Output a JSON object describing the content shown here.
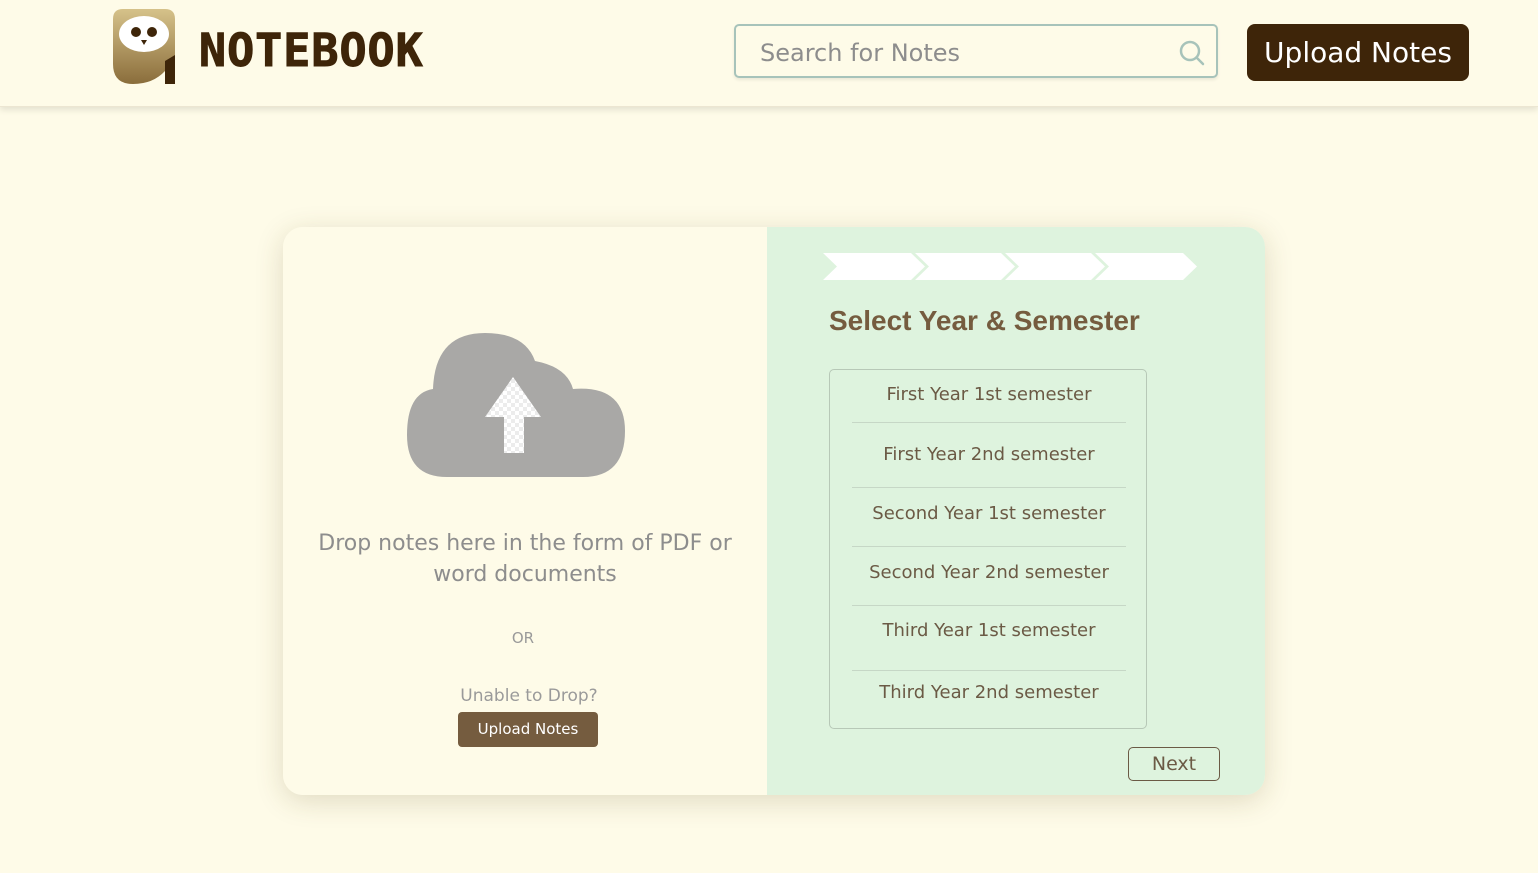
{
  "header": {
    "brand": "NOTEBOOK",
    "logo": "owl-logo-icon",
    "search": {
      "placeholder": "Search for Notes",
      "icon": "search-icon"
    },
    "upload_label": "Upload Notes"
  },
  "upload_panel": {
    "icon": "cloud-upload-icon",
    "drop_text": "Drop notes here in the form of PDF or word documents",
    "or_text": "OR",
    "unable_text": "Unable to Drop?",
    "upload_label": "Upload Notes"
  },
  "select_panel": {
    "title": "Select Year & Semester",
    "semesters": [
      "First Year 1st semester",
      "First Year 2nd semester",
      "Second Year 1st semester",
      "Second Year 2nd semester",
      "Third Year 1st semester",
      "Third Year 2nd semester"
    ],
    "next_label": "Next",
    "progress_steps": 4
  },
  "colors": {
    "background": "#fefbe8",
    "brand_dark": "#3e2509",
    "accent_brown": "#755c3f",
    "panel_green": "#def3de"
  }
}
